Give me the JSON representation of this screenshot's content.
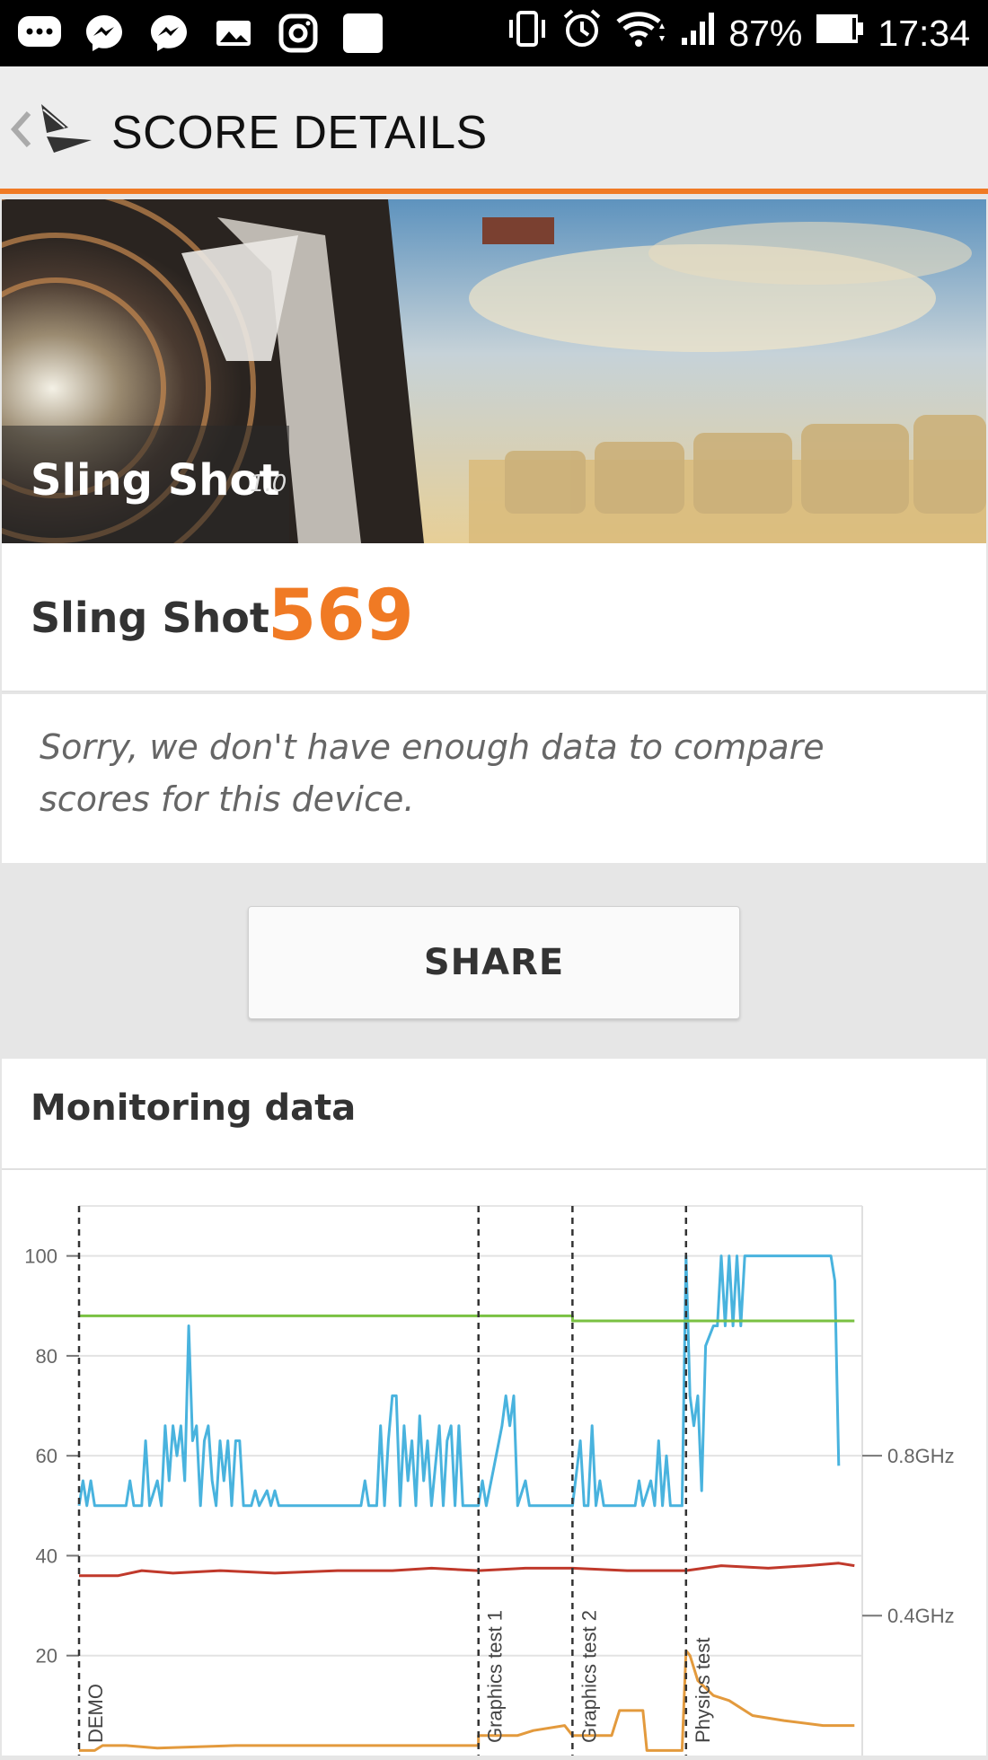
{
  "status_bar": {
    "battery": "87%",
    "time": "17:34",
    "left_icons": [
      "chat-bubble-icon",
      "messenger-icon",
      "messenger-icon",
      "photo-icon",
      "instagram-icon",
      "app-square-icon"
    ],
    "right_icons": [
      "vibrate-icon",
      "alarm-icon",
      "wifi-icon",
      "signal-icon",
      "battery-icon"
    ]
  },
  "app_bar": {
    "title": "SCORE DETAILS"
  },
  "hero": {
    "title": "Sling Shot",
    "version": "1.0"
  },
  "score": {
    "label": "Sling Shot",
    "value": "569",
    "accent_color": "#f07a24"
  },
  "note": {
    "text": "Sorry, we don't have enough data to compare scores for this device."
  },
  "share_button": {
    "label": "SHARE"
  },
  "monitoring": {
    "title": "Monitoring data"
  },
  "chart_data": {
    "type": "line",
    "y_left_ticks": [
      100,
      80,
      60,
      40,
      20
    ],
    "ylim": [
      0,
      110
    ],
    "y_right_ticks": [
      "0.8GHz",
      "0.4GHz"
    ],
    "y_right_tick_positions": [
      60,
      28
    ],
    "sections": [
      {
        "label": "DEMO",
        "start": 0
      },
      {
        "label": "Graphics test 1",
        "start": 51
      },
      {
        "label": "Graphics test 2",
        "start": 63
      },
      {
        "label": "Physics test",
        "start": 77.5
      }
    ],
    "x_max": 100,
    "series": [
      {
        "color": "#49b3de",
        "points": [
          [
            0,
            50
          ],
          [
            0.5,
            55
          ],
          [
            1,
            50
          ],
          [
            1.5,
            55
          ],
          [
            2,
            50
          ],
          [
            6,
            50
          ],
          [
            6.5,
            55
          ],
          [
            7,
            50
          ],
          [
            8,
            50
          ],
          [
            8.5,
            63
          ],
          [
            9,
            50
          ],
          [
            10,
            55
          ],
          [
            10.5,
            50
          ],
          [
            11,
            66
          ],
          [
            11.5,
            55
          ],
          [
            12,
            66
          ],
          [
            12.5,
            60
          ],
          [
            13,
            66
          ],
          [
            13.5,
            55
          ],
          [
            14,
            86
          ],
          [
            14.5,
            63
          ],
          [
            15,
            66
          ],
          [
            15.5,
            50
          ],
          [
            16,
            63
          ],
          [
            16.5,
            66
          ],
          [
            17,
            55
          ],
          [
            17.5,
            50
          ],
          [
            18,
            63
          ],
          [
            18.5,
            55
          ],
          [
            19,
            63
          ],
          [
            19.5,
            50
          ],
          [
            20,
            63
          ],
          [
            20.5,
            63
          ],
          [
            21,
            50
          ],
          [
            22,
            50
          ],
          [
            22.5,
            53
          ],
          [
            23,
            50
          ],
          [
            24,
            53
          ],
          [
            24.5,
            50
          ],
          [
            25,
            53
          ],
          [
            25.5,
            50
          ],
          [
            28,
            50
          ],
          [
            29,
            50
          ],
          [
            30,
            50
          ],
          [
            36,
            50
          ],
          [
            36.5,
            55
          ],
          [
            37,
            50
          ],
          [
            38,
            50
          ],
          [
            38.5,
            66
          ],
          [
            39,
            50
          ],
          [
            39.5,
            63
          ],
          [
            40,
            72
          ],
          [
            40.5,
            72
          ],
          [
            41,
            50
          ],
          [
            41.5,
            66
          ],
          [
            42,
            55
          ],
          [
            42.5,
            63
          ],
          [
            43,
            50
          ],
          [
            43.5,
            68
          ],
          [
            44,
            55
          ],
          [
            44.5,
            63
          ],
          [
            45,
            50
          ],
          [
            46,
            66
          ],
          [
            46.5,
            50
          ],
          [
            47,
            63
          ],
          [
            47.5,
            66
          ],
          [
            48,
            50
          ],
          [
            48.5,
            66
          ],
          [
            49,
            50
          ],
          [
            50,
            50
          ],
          [
            51,
            50
          ],
          [
            51.5,
            55
          ],
          [
            52,
            50
          ],
          [
            53,
            58
          ],
          [
            54,
            66
          ],
          [
            54.5,
            72
          ],
          [
            55,
            66
          ],
          [
            55.5,
            72
          ],
          [
            56,
            50
          ],
          [
            57,
            55
          ],
          [
            57.5,
            50
          ],
          [
            62,
            50
          ],
          [
            63,
            50
          ],
          [
            64,
            63
          ],
          [
            64.5,
            50
          ],
          [
            65,
            50
          ],
          [
            65.5,
            66
          ],
          [
            66,
            50
          ],
          [
            66.5,
            55
          ],
          [
            67,
            50
          ],
          [
            71,
            50
          ],
          [
            71.5,
            55
          ],
          [
            72,
            50
          ],
          [
            73,
            55
          ],
          [
            73.5,
            50
          ],
          [
            74,
            63
          ],
          [
            74.5,
            50
          ],
          [
            75,
            60
          ],
          [
            75.5,
            50
          ],
          [
            77,
            50
          ],
          [
            77.5,
            100
          ],
          [
            78,
            72
          ],
          [
            78.5,
            66
          ],
          [
            79,
            72
          ],
          [
            79.5,
            53
          ],
          [
            80,
            82
          ],
          [
            81,
            86
          ],
          [
            81.5,
            86
          ],
          [
            82,
            100
          ],
          [
            82.5,
            86
          ],
          [
            83,
            100
          ],
          [
            83.5,
            86
          ],
          [
            84,
            100
          ],
          [
            84.5,
            86
          ],
          [
            85,
            100
          ],
          [
            86,
            100
          ],
          [
            96,
            100
          ],
          [
            96.5,
            95
          ],
          [
            97,
            58
          ]
        ]
      },
      {
        "color": "#7ac142",
        "points": [
          [
            0,
            88
          ],
          [
            51,
            88
          ],
          [
            63,
            88
          ],
          [
            63,
            87
          ],
          [
            99,
            87
          ]
        ]
      },
      {
        "color": "#c0392b",
        "points": [
          [
            0,
            36
          ],
          [
            5,
            36
          ],
          [
            8,
            37
          ],
          [
            12,
            36.5
          ],
          [
            18,
            37
          ],
          [
            25,
            36.5
          ],
          [
            33,
            37
          ],
          [
            40,
            37
          ],
          [
            45,
            37.5
          ],
          [
            51,
            37
          ],
          [
            57,
            37.5
          ],
          [
            63,
            37.5
          ],
          [
            70,
            37
          ],
          [
            77.5,
            37
          ],
          [
            82,
            38
          ],
          [
            88,
            37.5
          ],
          [
            93,
            38
          ],
          [
            97,
            38.5
          ],
          [
            99,
            38
          ]
        ]
      },
      {
        "color": "#e39a3d",
        "points": [
          [
            0,
            1
          ],
          [
            2,
            1
          ],
          [
            3,
            2
          ],
          [
            6,
            2
          ],
          [
            10,
            1.5
          ],
          [
            20,
            2
          ],
          [
            30,
            2
          ],
          [
            40,
            2
          ],
          [
            51,
            2
          ],
          [
            51,
            4
          ],
          [
            56,
            4
          ],
          [
            58,
            5
          ],
          [
            62,
            6
          ],
          [
            63,
            4
          ],
          [
            66,
            4
          ],
          [
            68,
            4
          ],
          [
            69,
            9
          ],
          [
            72,
            9
          ],
          [
            72.5,
            1
          ],
          [
            77,
            1
          ],
          [
            77.5,
            21
          ],
          [
            78,
            20
          ],
          [
            79,
            15
          ],
          [
            81,
            12
          ],
          [
            83,
            11
          ],
          [
            86,
            8
          ],
          [
            90,
            7
          ],
          [
            95,
            6
          ],
          [
            99,
            6
          ]
        ]
      }
    ]
  }
}
